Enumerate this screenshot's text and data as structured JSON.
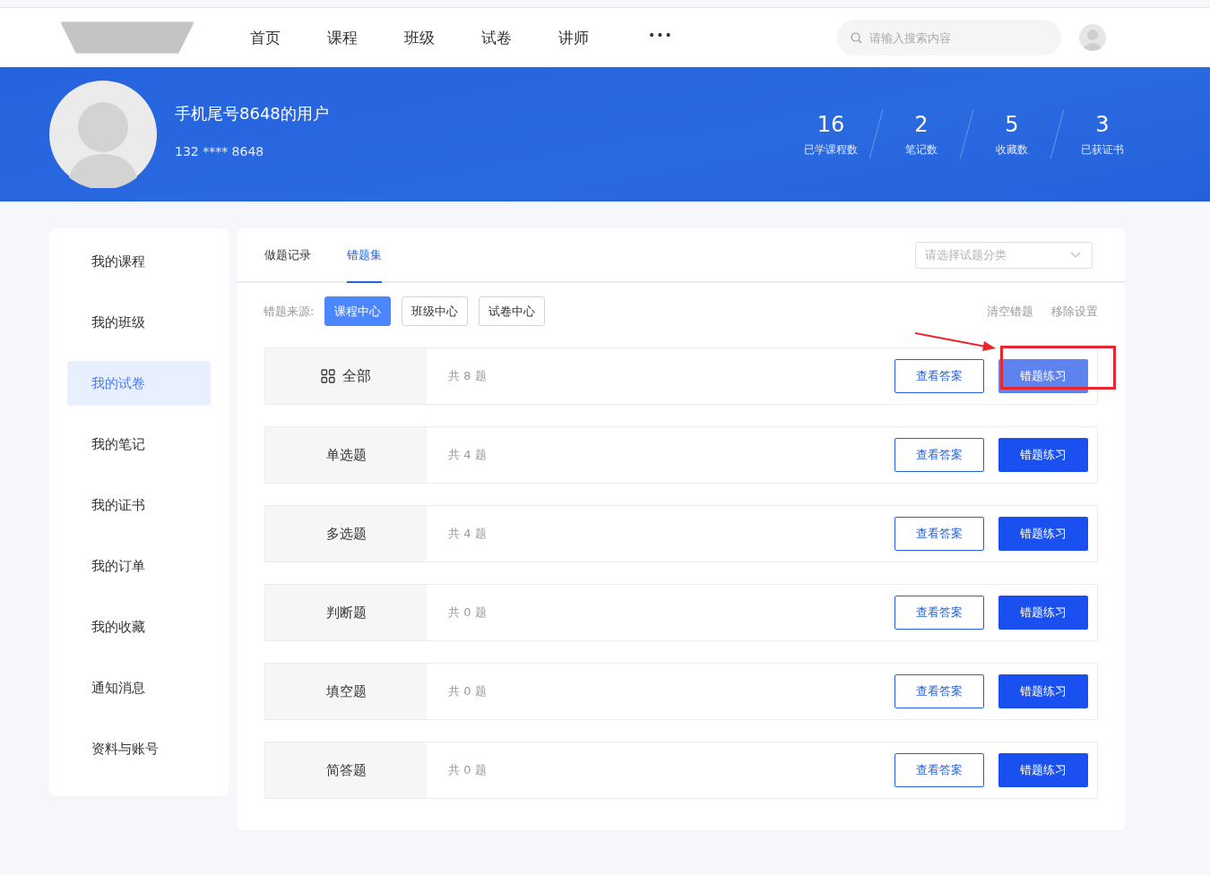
{
  "nav": {
    "items": [
      {
        "label": "首页",
        "selected": false
      },
      {
        "label": "课程",
        "selected": false
      },
      {
        "label": "班级",
        "selected": false
      },
      {
        "label": "试卷",
        "selected": false
      },
      {
        "label": "讲师",
        "selected": false
      }
    ],
    "more": "•••",
    "search_placeholder": "请输入搜索内容"
  },
  "profile": {
    "name": "手机尾号8648的用户",
    "phone": "132 **** 8648",
    "stats": [
      {
        "value": "16",
        "label": "已学课程数"
      },
      {
        "value": "2",
        "label": "笔记数"
      },
      {
        "value": "5",
        "label": "收藏数"
      },
      {
        "value": "3",
        "label": "已获证书"
      }
    ]
  },
  "sidebar": {
    "items": [
      {
        "label": "我的课程",
        "selected": false
      },
      {
        "label": "我的班级",
        "selected": false
      },
      {
        "label": "我的试卷",
        "selected": true
      },
      {
        "label": "我的笔记",
        "selected": false
      },
      {
        "label": "我的证书",
        "selected": false
      },
      {
        "label": "我的订单",
        "selected": false
      },
      {
        "label": "我的收藏",
        "selected": false
      },
      {
        "label": "通知消息",
        "selected": false
      },
      {
        "label": "资料与账号",
        "selected": false
      }
    ]
  },
  "tabs": [
    {
      "label": "做题记录",
      "selected": false
    },
    {
      "label": "错题集",
      "selected": true
    }
  ],
  "category_select": {
    "placeholder": "请选择试题分类"
  },
  "source": {
    "label": "错题来源:",
    "options": [
      {
        "label": "课程中心",
        "selected": true
      },
      {
        "label": "班级中心",
        "selected": false
      },
      {
        "label": "试卷中心",
        "selected": false
      }
    ]
  },
  "actions": [
    "清空错题",
    "移除设置"
  ],
  "rows": [
    {
      "kind": "all",
      "name": "全部",
      "count": "共 8 题",
      "view": "查看答案",
      "practice": "错题练习",
      "hover": true
    },
    {
      "kind": "type",
      "name": "单选题",
      "count": "共 4 题",
      "view": "查看答案",
      "practice": "错题练习",
      "hover": false
    },
    {
      "kind": "type",
      "name": "多选题",
      "count": "共 4 题",
      "view": "查看答案",
      "practice": "错题练习",
      "hover": false
    },
    {
      "kind": "type",
      "name": "判断题",
      "count": "共 0 题",
      "view": "查看答案",
      "practice": "错题练习",
      "hover": false
    },
    {
      "kind": "type",
      "name": "填空题",
      "count": "共 0 题",
      "view": "查看答案",
      "practice": "错题练习",
      "hover": false
    },
    {
      "kind": "type",
      "name": "简答题",
      "count": "共 0 题",
      "view": "查看答案",
      "practice": "错题练习",
      "hover": false
    }
  ]
}
